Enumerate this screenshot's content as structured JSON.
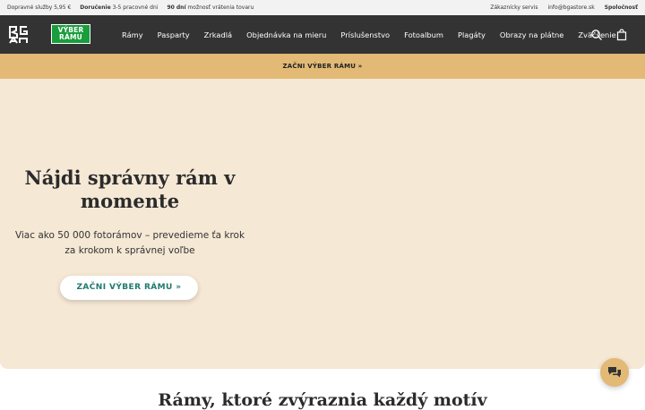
{
  "topbar": {
    "shipping_label": "Dopravné služby 5,95 €",
    "delivery_bold": "Doručenie",
    "delivery_rest": "3-5 pracovné dni",
    "returns_bold": "90 dní",
    "returns_rest": "možnosť vrátenia tovaru",
    "customer_service": "Zákaznícky servis",
    "email": "info@bgastore.sk",
    "company": "Spoločnosť"
  },
  "nav": {
    "logo_icon": "bga-logo",
    "frame_badge_line1": "VÝBER",
    "frame_badge_line2": "RÁMU",
    "items": [
      {
        "label": "Rámy"
      },
      {
        "label": "Pasparty"
      },
      {
        "label": "Zrkadlá"
      },
      {
        "label": "Objednávka na mieru"
      },
      {
        "label": "Príslušenstvo"
      },
      {
        "label": "Fotoalbum"
      },
      {
        "label": "Plagáty"
      },
      {
        "label": "Obrazy na plátne"
      },
      {
        "label": "Zväčšenie"
      }
    ],
    "search_icon": "search-icon",
    "cart_icon": "shopping-bag-icon"
  },
  "promo": {
    "label": "ZAČNI VÝBER RÁMU »"
  },
  "hero": {
    "title": "Nájdi správny rám v momente",
    "subtitle": "Viac ako 50 000 fotorámov – prevedieme ťa krok za krokom k správnej voľbe",
    "cta_label": "ZAČNI VÝBER RÁMU »"
  },
  "chat": {
    "icon": "chat-icon"
  },
  "section": {
    "title": "Rámy, ktoré zvýraznia každý motív"
  },
  "colors": {
    "nav_bg": "#333333",
    "promo_bg": "#e2b975",
    "hero_bg": "#f5e8d5",
    "badge_green": "#1a9d3c",
    "cta_text": "#1f7a6d"
  }
}
